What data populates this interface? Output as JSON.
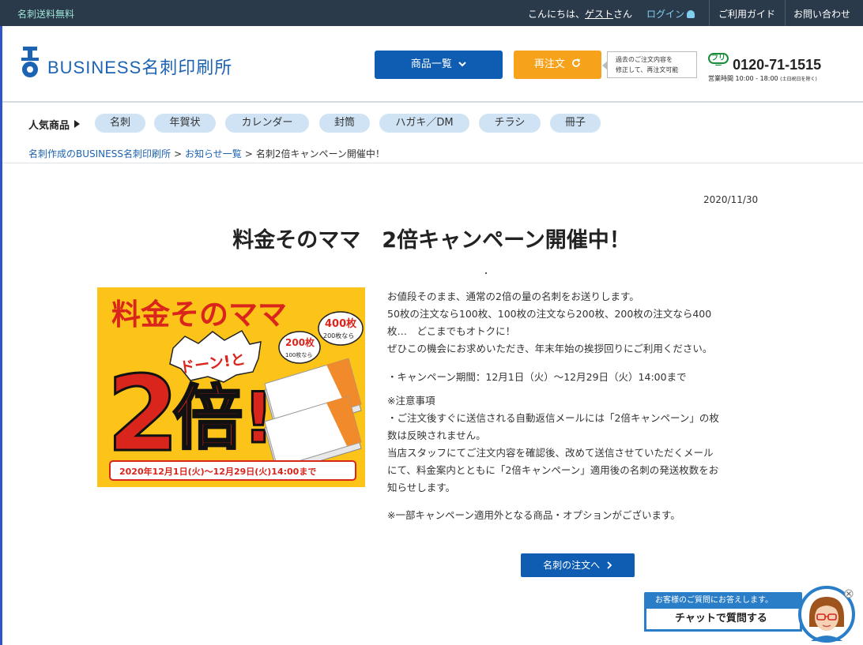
{
  "topbar": {
    "free_shipping": "名刺送料無料",
    "greeting_prefix": "こんにちは、",
    "guest": "ゲスト",
    "greeting_suffix": "さん",
    "login": "ログイン",
    "guide": "ご利用ガイド",
    "contact": "お問い合わせ"
  },
  "header": {
    "logo_text": "BUSINESS名刺印刷所",
    "products_button": "商品一覧",
    "reorder_button": "再注文",
    "reorder_note_line1": "過去のご注文内容を",
    "reorder_note_line2": "修正して、再注文可能",
    "freedial_label": "フリー",
    "phone": "0120-71-1515",
    "hours": "営業時間 10:00 - 18:00",
    "hours_note": "(土日祝日を除く)"
  },
  "popular": {
    "label": "人気商品",
    "items": [
      "名刺",
      "年賀状",
      "カレンダー",
      "封筒",
      "ハガキ／DM",
      "チラシ",
      "冊子"
    ]
  },
  "breadcrumb": {
    "home": "名刺作成のBUSINESS名刺印刷所",
    "news": "お知らせ一覧",
    "current": "名刺2倍キャンペーン開催中！",
    "sep": ">"
  },
  "article": {
    "date": "2020/11/30",
    "title": "料金そのママ　2倍キャンペーン開催中！",
    "lines": [
      "お値段そのまま、通常の2倍の量の名刺をお送りします。",
      "50枚の注文なら100枚、100枚の注文なら200枚、200枚の注文なら400",
      "枚…　どこまでもオトクに！",
      "ぜひこの機会にお求めいただき、年末年始の挨拶回りにご利用ください。"
    ],
    "period": "・キャンペーン期間：12月1日（火）～12月29日（火）14:00まで",
    "notes_heading": "※注意事項",
    "notes_lines": [
      "・ご注文後すぐに送信される自動返信メールには「2倍キャンペーン」の枚",
      "数は反映されません。",
      "当店スタッフにてご注文内容を確認後、改めて送信させていただくメール",
      "にて、料金案内とともに「2倍キャンペーン」適用後の名刺の発送枚数をお",
      "知らせします。"
    ],
    "exclusion": "※一部キャンペーン適用外となる商品・オプションがございます。",
    "order_button": "名刺の注文へ"
  },
  "banner": {
    "headline": "料金そのママ",
    "big1": "2",
    "big2": "倍!",
    "doon": "ドーン!と",
    "b200": "200枚",
    "b100": "100枚なら",
    "b400": "400枚",
    "b200b": "200枚なら",
    "dates": "2020年12月1日(火)～12月29日(火)14:00まで"
  },
  "chat": {
    "head": "お客様のご質問にお答えします。",
    "button": "チャットで質問する"
  },
  "colors": {
    "topbar": "#2b3a4a",
    "brand_blue": "#0f5db3",
    "orange": "#f7a21b",
    "pill": "#cfe3f5",
    "banner_yellow": "#fcc419",
    "banner_red": "#d9251c"
  }
}
